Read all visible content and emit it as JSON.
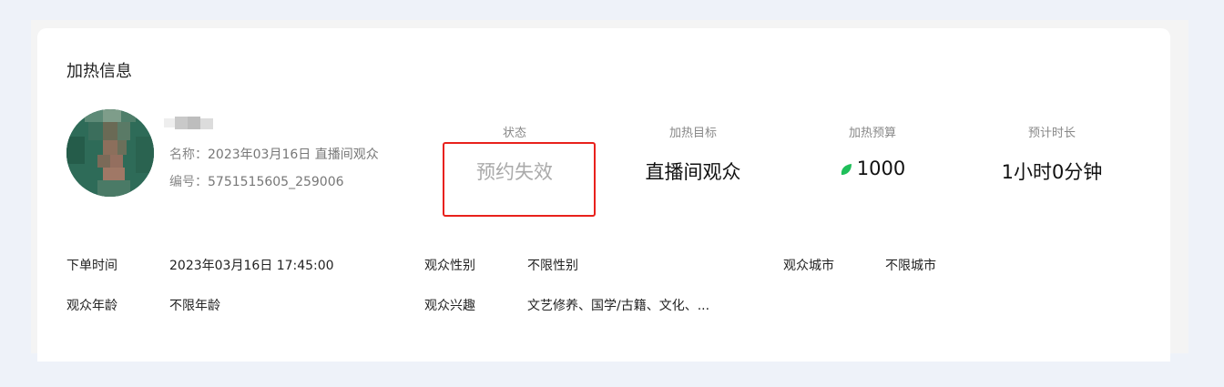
{
  "section": {
    "title": "加热信息"
  },
  "profile": {
    "name_label": "名称：",
    "name_value": "2023年03月16日 直播间观众",
    "id_label": "编号：",
    "id_value": "5751515605_259006"
  },
  "stats": {
    "status": {
      "label": "状态",
      "value": "预约失效"
    },
    "target": {
      "label": "加热目标",
      "value": "直播间观众"
    },
    "budget": {
      "label": "加热预算",
      "value": "1000",
      "icon": "leaf-icon"
    },
    "duration": {
      "label": "预计时长",
      "value": "1小时0分钟"
    }
  },
  "details": {
    "order_time": {
      "label": "下单时间",
      "value": "2023年03月16日 17:45:00"
    },
    "gender": {
      "label": "观众性别",
      "value": "不限性别"
    },
    "city": {
      "label": "观众城市",
      "value": "不限城市"
    },
    "age": {
      "label": "观众年龄",
      "value": "不限年龄"
    },
    "interest": {
      "label": "观众兴趣",
      "value": "文艺修养、国学/古籍、文化、..."
    }
  },
  "colors": {
    "page_bg": "#eef2f9",
    "card_bg": "#ffffff",
    "highlight": "#e8211c",
    "leaf": "#1fbf5a",
    "muted": "#888888"
  }
}
